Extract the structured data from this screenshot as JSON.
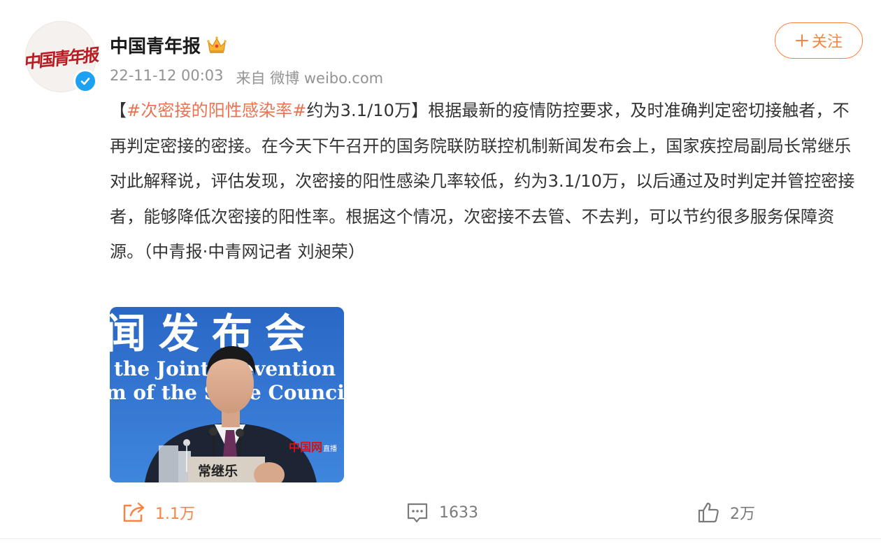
{
  "post": {
    "author": {
      "name": "中国青年报",
      "avatar_text": "中国青年报",
      "badge": "verified-icon",
      "member_icon": "crown-icon"
    },
    "meta": {
      "timestamp": "22-11-12 00:03",
      "source": "来自 微博 weibo.com"
    },
    "follow_label": "关注",
    "text": {
      "open_bracket": "【",
      "hashtag": "#次密接的阳性感染率#",
      "headline_rest": "约为3.1/10万】",
      "body": "根据最新的疫情防控要求，及时准确判定密切接触者，不再判定密接的密接。在今天下午召开的国务院联防联控机制新闻发布会上，国家疾控局副局长常继乐对此解释说，评估发现，次密接的阳性感染几率较低，约为3.1/10万，以后通过及时判定并管控密接者，能够降低次密接的阳性率。根据这个情况，次密接不去管、不去判，可以节约很多服务保障资源。（中青报·中青网记者 刘昶荣）"
    },
    "image": {
      "banner_cn": "闻发布会",
      "banner_en_1": "the Joint Prevention",
      "banner_en_2": "m of the State Council",
      "nameplate": "常继乐",
      "watermark": "中国网",
      "watermark_sub": "直播"
    },
    "actions": {
      "repost_count": "1.1万",
      "comment_count": "1633",
      "like_count": "2万"
    }
  },
  "colors": {
    "accent": "#ff8140",
    "hashtag": "#eb7350",
    "verified": "#1da1f2"
  }
}
